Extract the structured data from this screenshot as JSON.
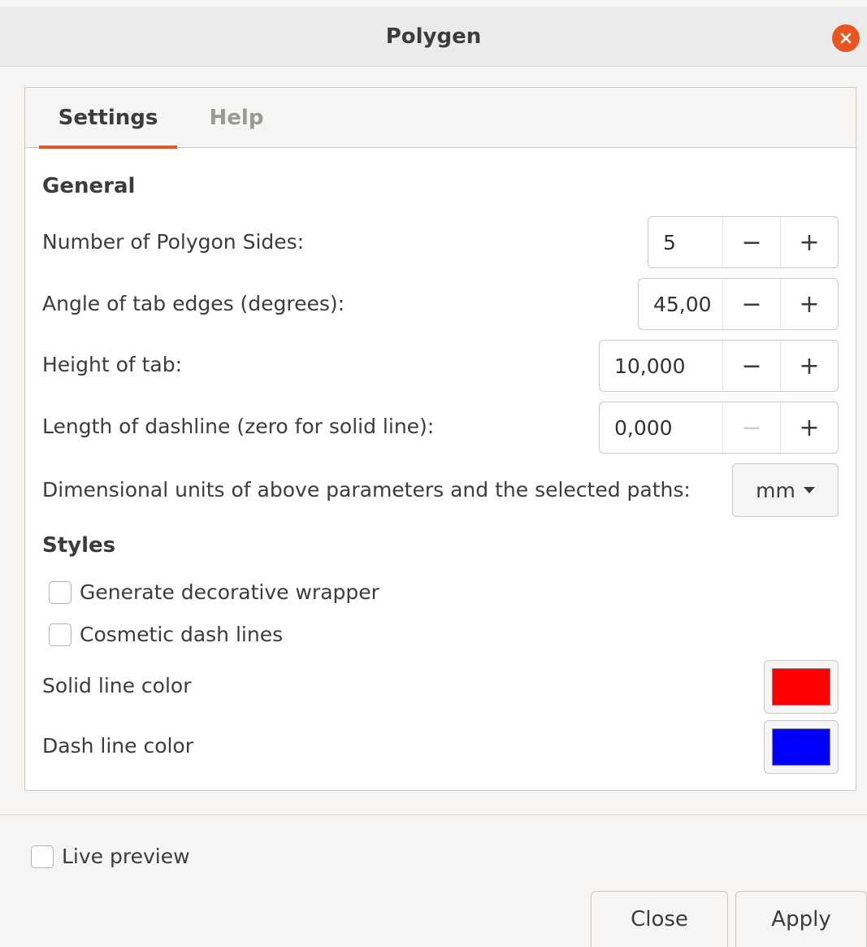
{
  "window": {
    "title": "Polygen"
  },
  "tabs": [
    {
      "label": "Settings",
      "active": true
    },
    {
      "label": "Help",
      "active": false
    }
  ],
  "general": {
    "heading": "General",
    "rows": [
      {
        "label": "Number of Polygon Sides:",
        "value": "5"
      },
      {
        "label": "Angle of tab edges (degrees):",
        "value": "45,00"
      },
      {
        "label": "Height of tab:",
        "value": "10,000"
      },
      {
        "label": "Length of dashline (zero for solid line):",
        "value": "0,000"
      }
    ],
    "units": {
      "label": "Dimensional units of above parameters and the selected paths:",
      "value": "mm"
    }
  },
  "styles": {
    "heading": "Styles",
    "checkboxes": [
      {
        "label": "Generate decorative wrapper",
        "checked": false
      },
      {
        "label": "Cosmetic dash lines",
        "checked": false
      }
    ],
    "colors": [
      {
        "label": "Solid line color",
        "color": "#ff0000"
      },
      {
        "label": "Dash line color",
        "color": "#0000ff"
      }
    ]
  },
  "footer": {
    "live_preview": {
      "label": "Live preview",
      "checked": false
    },
    "close_label": "Close",
    "apply_label": "Apply"
  },
  "icons": {
    "minus": "−",
    "plus": "+"
  },
  "accent": "#e95420"
}
